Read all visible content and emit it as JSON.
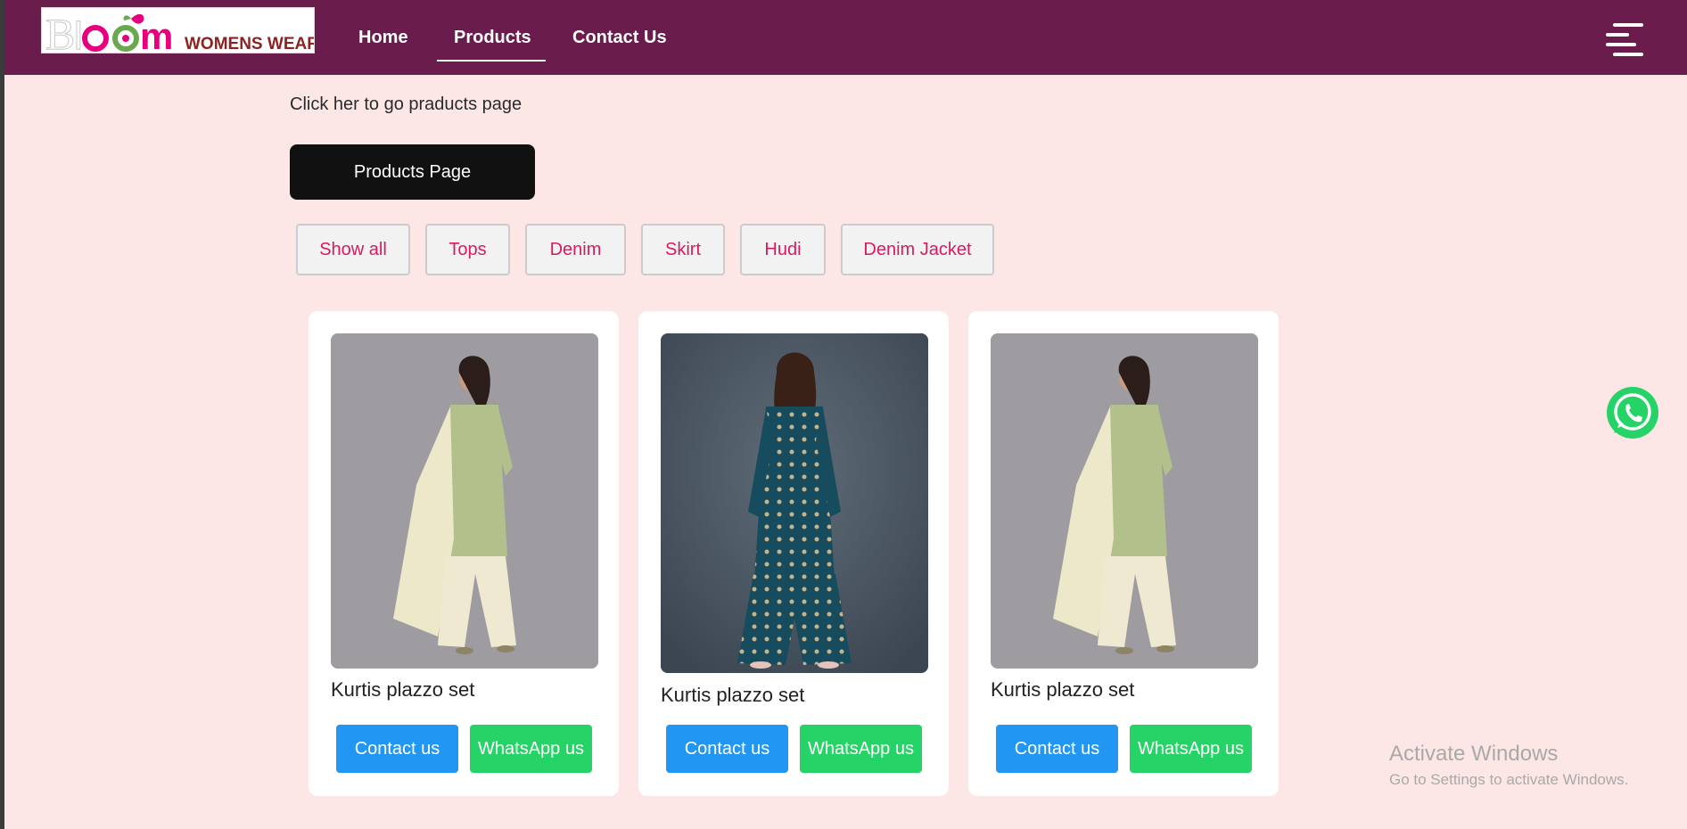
{
  "logo": {
    "brand_text": "Bloom",
    "tagline": "WOMENS WEAR",
    "colors": {
      "brand": "#e6007e",
      "tagline": "#8b2323"
    }
  },
  "nav": {
    "items": [
      {
        "label": "Home",
        "active": false
      },
      {
        "label": "Products",
        "active": true
      },
      {
        "label": "Contact Us",
        "active": false
      }
    ],
    "menu_icon": "hamburger-icon",
    "background": "#6a1c4c"
  },
  "intro": {
    "text": "Click her to go praducts page",
    "button_label": "Products Page"
  },
  "filters": [
    "Show all",
    "Tops",
    "Denim",
    "Skirt",
    "Hudi",
    "Denim Jacket"
  ],
  "products": [
    {
      "title": "Kurtis plazzo set",
      "image": "kurti-green-photo",
      "contact_label": "Contact us",
      "whatsapp_label": "WhatsApp us"
    },
    {
      "title": "Kurtis plazzo set",
      "image": "kurti-teal-photo",
      "contact_label": "Contact us",
      "whatsapp_label": "WhatsApp us"
    },
    {
      "title": "Kurtis plazzo set",
      "image": "kurti-green-photo",
      "contact_label": "Contact us",
      "whatsapp_label": "WhatsApp us"
    }
  ],
  "floating": {
    "icon": "whatsapp-icon",
    "color": "#25d366"
  },
  "watermark": {
    "title": "Activate Windows",
    "subtitle": "Go to Settings to activate Windows."
  }
}
